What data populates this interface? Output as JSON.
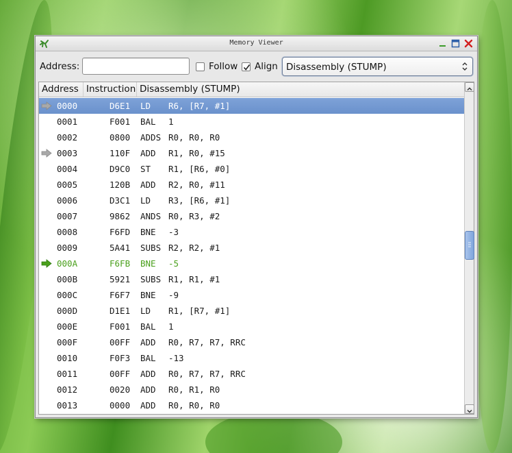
{
  "window": {
    "title": "Memory Viewer"
  },
  "toolbar": {
    "address_label": "Address:",
    "address_value": "",
    "follow_label": "Follow",
    "follow_checked": false,
    "align_label": "Align",
    "align_checked": true,
    "view_mode": "Disassembly (STUMP)"
  },
  "table": {
    "columns": [
      "Address",
      "Instruction",
      "Disassembly (STUMP)"
    ],
    "rows": [
      {
        "addr": "0000",
        "instr": "D6E1",
        "mn": "LD",
        "ops": "R6, [R7, #1]",
        "marker": "gray",
        "state": "selected"
      },
      {
        "addr": "0001",
        "instr": "F001",
        "mn": "BAL",
        "ops": "1",
        "marker": "",
        "state": ""
      },
      {
        "addr": "0002",
        "instr": "0800",
        "mn": "ADDS",
        "ops": "R0, R0, R0",
        "marker": "",
        "state": ""
      },
      {
        "addr": "0003",
        "instr": "110F",
        "mn": "ADD",
        "ops": "R1, R0, #15",
        "marker": "gray",
        "state": ""
      },
      {
        "addr": "0004",
        "instr": "D9C0",
        "mn": "ST",
        "ops": "R1, [R6, #0]",
        "marker": "",
        "state": ""
      },
      {
        "addr": "0005",
        "instr": "120B",
        "mn": "ADD",
        "ops": "R2, R0, #11",
        "marker": "",
        "state": ""
      },
      {
        "addr": "0006",
        "instr": "D3C1",
        "mn": "LD",
        "ops": "R3, [R6, #1]",
        "marker": "",
        "state": ""
      },
      {
        "addr": "0007",
        "instr": "9862",
        "mn": "ANDS",
        "ops": "R0, R3, #2",
        "marker": "",
        "state": ""
      },
      {
        "addr": "0008",
        "instr": "F6FD",
        "mn": "BNE",
        "ops": "-3",
        "marker": "",
        "state": ""
      },
      {
        "addr": "0009",
        "instr": "5A41",
        "mn": "SUBS",
        "ops": "R2, R2, #1",
        "marker": "",
        "state": ""
      },
      {
        "addr": "000A",
        "instr": "F6FB",
        "mn": "BNE",
        "ops": "-5",
        "marker": "green",
        "state": "current"
      },
      {
        "addr": "000B",
        "instr": "5921",
        "mn": "SUBS",
        "ops": "R1, R1, #1",
        "marker": "",
        "state": ""
      },
      {
        "addr": "000C",
        "instr": "F6F7",
        "mn": "BNE",
        "ops": "-9",
        "marker": "",
        "state": ""
      },
      {
        "addr": "000D",
        "instr": "D1E1",
        "mn": "LD",
        "ops": "R1, [R7, #1]",
        "marker": "",
        "state": ""
      },
      {
        "addr": "000E",
        "instr": "F001",
        "mn": "BAL",
        "ops": "1",
        "marker": "",
        "state": ""
      },
      {
        "addr": "000F",
        "instr": "00FF",
        "mn": "ADD",
        "ops": "R0, R7, R7, RRC",
        "marker": "",
        "state": ""
      },
      {
        "addr": "0010",
        "instr": "F0F3",
        "mn": "BAL",
        "ops": "-13",
        "marker": "",
        "state": ""
      },
      {
        "addr": "0011",
        "instr": "00FF",
        "mn": "ADD",
        "ops": "R0, R7, R7, RRC",
        "marker": "",
        "state": ""
      },
      {
        "addr": "0012",
        "instr": "0020",
        "mn": "ADD",
        "ops": "R0, R1, R0",
        "marker": "",
        "state": ""
      },
      {
        "addr": "0013",
        "instr": "0000",
        "mn": "ADD",
        "ops": "R0, R0, R0",
        "marker": "",
        "state": ""
      }
    ]
  },
  "scrollbar": {
    "position_fraction": 0.49
  },
  "colors": {
    "selection": "#7399d2",
    "current_line": "#4aa01c",
    "breakpoint_marker": "#a9a9a9"
  }
}
